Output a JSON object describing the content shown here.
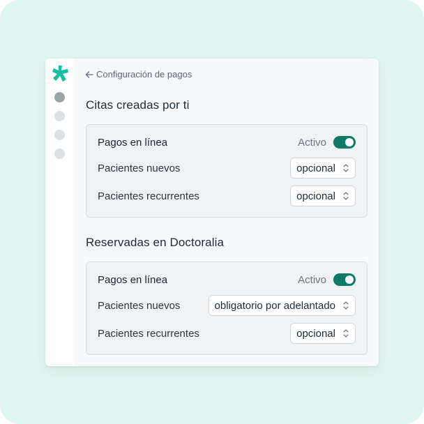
{
  "colors": {
    "accent": "#0f7a68",
    "logo": "#14c1a0",
    "background": "#dff7f0"
  },
  "sidebar": {
    "logo_icon": "doctoralia-logo-icon",
    "items": [
      {
        "name": "nav-item-1",
        "active": true
      },
      {
        "name": "nav-item-2",
        "active": false
      },
      {
        "name": "nav-item-3",
        "active": false
      },
      {
        "name": "nav-item-4",
        "active": false
      }
    ]
  },
  "header": {
    "back_icon": "arrow-left-icon",
    "back_label": "Configuración de pagos"
  },
  "sections": [
    {
      "title": "Citas creadas por ti",
      "online_payments_label": "Pagos en línea",
      "status_label": "Activo",
      "toggle_on": true,
      "new_patients_label": "Pacientes nuevos",
      "new_patients_value": "opcional",
      "returning_patients_label": "Pacientes recurrentes",
      "returning_patients_value": "opcional"
    },
    {
      "title": "Reservadas en Doctoralia",
      "online_payments_label": "Pagos en línea",
      "status_label": "Activo",
      "toggle_on": true,
      "new_patients_label": "Pacientes nuevos",
      "new_patients_value": "obligatorio por adelantado",
      "returning_patients_label": "Pacientes recurrentes",
      "returning_patients_value": "opcional"
    }
  ]
}
